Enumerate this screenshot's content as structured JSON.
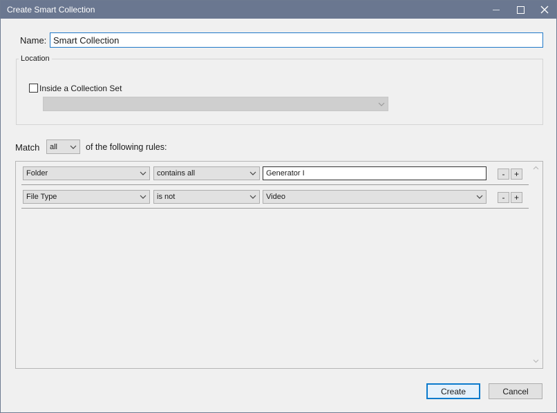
{
  "window": {
    "title": "Create Smart Collection"
  },
  "name": {
    "label": "Name:",
    "value": "Smart Collection"
  },
  "location": {
    "legend": "Location",
    "inside_set_label": "Inside a Collection Set",
    "inside_set_checked": false,
    "collection_set_value": ""
  },
  "match": {
    "prefix": "Match",
    "selected": "all",
    "suffix": "of the following rules:"
  },
  "rules": [
    {
      "field": "Folder",
      "operator": "contains all",
      "value": "Generator I",
      "value_kind": "text"
    },
    {
      "field": "File Type",
      "operator": "is not",
      "value": "Video",
      "value_kind": "select"
    }
  ],
  "rule_buttons": {
    "remove": "-",
    "add": "+"
  },
  "footer": {
    "create": "Create",
    "cancel": "Cancel"
  },
  "colors": {
    "titlebar": "#6a7790",
    "focus_border": "#1e78c8",
    "primary_border": "#0a7acc"
  }
}
